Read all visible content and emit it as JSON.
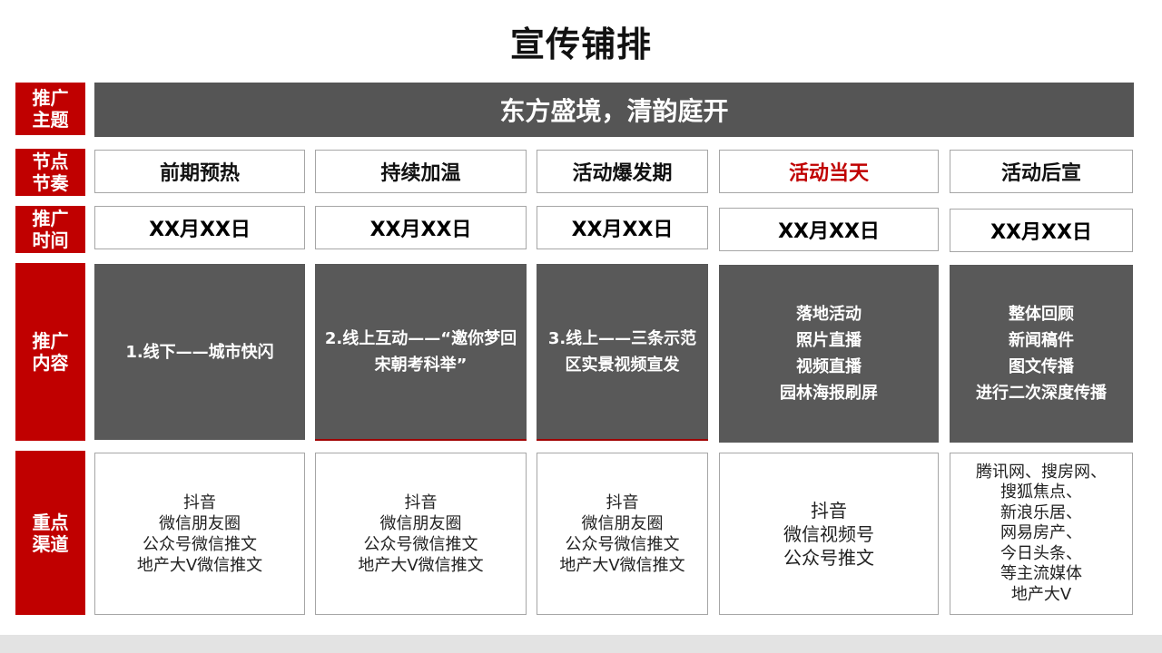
{
  "title": "宣传铺排",
  "row_labels": {
    "theme": "推广\n主题",
    "rhythm": "节点\n节奏",
    "time": "推广\n时间",
    "content": "推广\n内容",
    "channels": "重点\n渠道"
  },
  "theme": "东方盛境，清韵庭开",
  "columns": [
    {
      "stage": "前期预热",
      "date": "XX月XX日",
      "content": "1.线下——城市快闪",
      "channels": "抖音\n微信朋友圈\n公众号微信推文\n地产大V微信推文"
    },
    {
      "stage": "持续加温",
      "date": "XX月XX日",
      "content": "2.线上互动——“邀你梦回宋朝考科举”",
      "channels": "抖音\n微信朋友圈\n公众号微信推文\n地产大V微信推文"
    },
    {
      "stage": "活动爆发期",
      "date": "XX月XX日",
      "content": "3.线上——三条示范区实景视频宣发",
      "channels": "抖音\n微信朋友圈\n公众号微信推文\n地产大V微信推文"
    },
    {
      "stage": "活动当天",
      "date": "XX月XX日",
      "content": "落地活动\n照片直播\n视频直播\n园林海报刷屏",
      "channels": "抖音\n微信视频号\n公众号推文"
    },
    {
      "stage": "活动后宣",
      "date": "XX月XX日",
      "content": "整体回顾\n新闻稿件\n图文传播\n进行二次深度传播",
      "channels": "腾讯网、搜房网、\n搜狐焦点、\n新浪乐居、\n网易房产、\n今日头条、\n等主流媒体\n地产大V"
    }
  ],
  "colors": {
    "accent": "#c00000",
    "dark_cell": "#595959",
    "border": "#a6a6a6"
  }
}
